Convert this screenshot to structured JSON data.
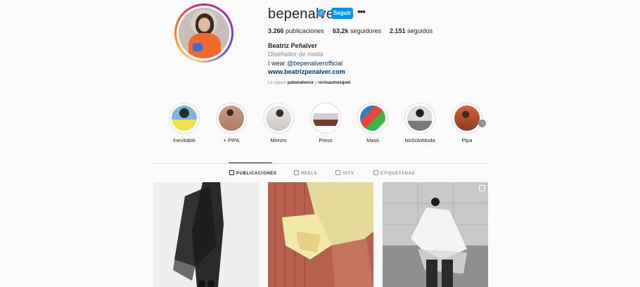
{
  "profile": {
    "username": "bepenalver",
    "verified_mark": "✓",
    "follow_label": "Seguir",
    "more_label": "•••",
    "stats": {
      "posts_count": "3.266",
      "posts_label": "publicaciones",
      "followers_count": "63,2k",
      "followers_label": "seguidores",
      "following_count": "2.151",
      "following_label": "seguidos"
    },
    "full_name": "Beatriz Peñalver",
    "category": "Diseñador de moda",
    "bio_prefix": "I wear ",
    "bio_mention": "@bepenalverofficial",
    "website": "www.beatrizpenalver.com",
    "followed_by_prefix": "Le siguen ",
    "followed_by_user1": "palomaherce",
    "followed_by_sep": " y ",
    "followed_by_user2": "rocioaumesquet"
  },
  "highlights": [
    {
      "label": "Inevitable"
    },
    {
      "label": "+ PIPA"
    },
    {
      "label": "Mirrors"
    },
    {
      "label": "Press"
    },
    {
      "label": "Mask"
    },
    {
      "label": "NoSoloModa"
    },
    {
      "label": "Pipa"
    }
  ],
  "tabs": [
    {
      "label": "PUBLICACIONES",
      "icon": "grid-icon"
    },
    {
      "label": "REELS",
      "icon": "reels-icon"
    },
    {
      "label": "IGTV",
      "icon": "igtv-icon"
    },
    {
      "label": "ETIQUETADAS",
      "icon": "tagged-icon"
    }
  ],
  "colors": {
    "accent": "#0095f6",
    "verified": "#3897f0",
    "link": "#00376b",
    "muted": "#8e8e8e",
    "text": "#262626"
  }
}
